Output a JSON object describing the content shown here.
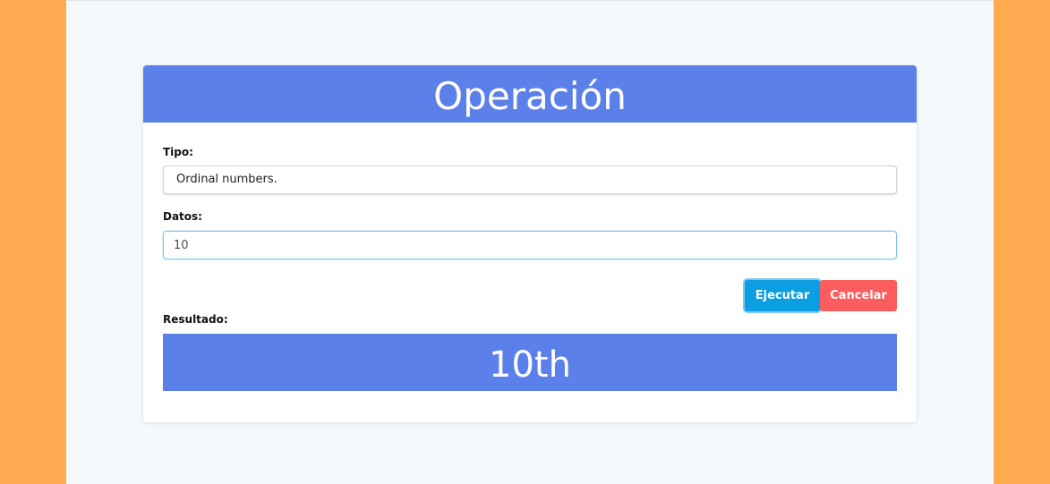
{
  "card": {
    "title": "Operación"
  },
  "form": {
    "tipo_label": "Tipo:",
    "tipo_value": "Ordinal numbers.",
    "datos_label": "Datos:",
    "datos_value": "10",
    "resultado_label": "Resultado:",
    "resultado_value": "10th"
  },
  "actions": {
    "execute_label": "Ejecutar",
    "cancel_label": "Cancelar"
  },
  "colors": {
    "background_side": "#ffaa50",
    "page_background": "#f6f9fc",
    "header_blue": "#5c80e9",
    "execute_button": "#0c9ee2",
    "cancel_button": "#fb5c5e"
  }
}
